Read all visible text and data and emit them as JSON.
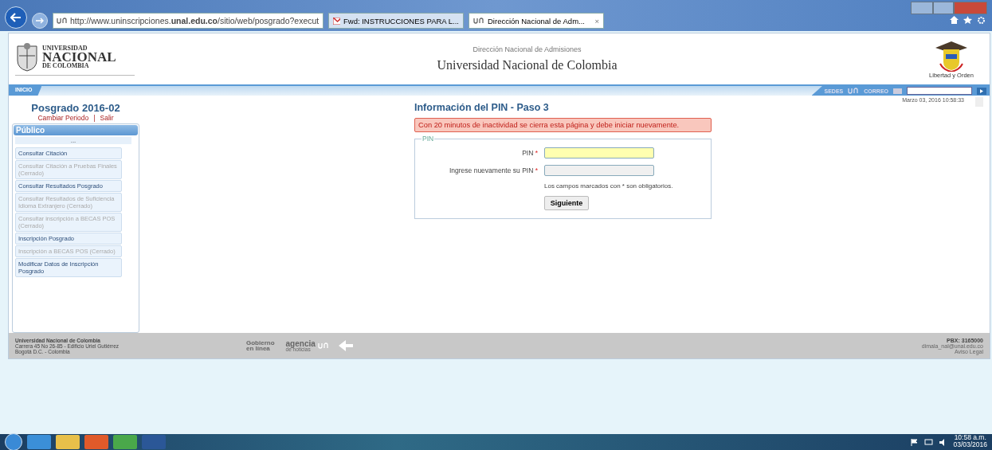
{
  "browser": {
    "address": "http://www.uninscripciones.**unal.edu.co**/sitio/web/posgrado?execut",
    "tabs": [
      {
        "label": "Fwd: INSTRUCCIONES PARA L...",
        "selected": false,
        "kind": "mail"
      },
      {
        "label": "Dirección Nacional de Adm...",
        "selected": true,
        "kind": "site",
        "close": "×"
      }
    ]
  },
  "header": {
    "logo_lines": [
      "UNIVERSIDAD",
      "NACIONAL",
      "DE COLOMBIA"
    ],
    "subtitle": "Dirección Nacional de Admisiones",
    "title": "Universidad Nacional de Colombia",
    "crest_motto": "Libertad y Orden"
  },
  "navbar": {
    "home": "INICIO",
    "links": [
      "SEDES",
      "CORREO"
    ]
  },
  "sidebar": {
    "title": "Posgrado 2016-02",
    "links": [
      "Cambiar Periodo",
      "Salir"
    ],
    "separator": "|",
    "section": "Público",
    "ellipsis": "...",
    "items": [
      {
        "label": "Consultar Citación",
        "disabled": false
      },
      {
        "label": "Consultar Citación a Pruebas Finales (Cerrado)",
        "disabled": true
      },
      {
        "label": "Consultar Resultados Posgrado",
        "disabled": false
      },
      {
        "label": "Consultar Resultados de Suficiencia Idioma Extranjero (Cerrado)",
        "disabled": true
      },
      {
        "label": "Consultar inscripción a BECAS POS (Cerrado)",
        "disabled": true
      },
      {
        "label": "Inscripción Posgrado",
        "disabled": false
      },
      {
        "label": "Inscripción a BECAS POS (Cerrado)",
        "disabled": true
      },
      {
        "label": "Modificar Datos de Inscripción Posgrado",
        "disabled": false
      }
    ]
  },
  "datetime": "Marzo 03, 2016 10:58:33",
  "main": {
    "title": "Información del PIN - Paso 3",
    "alert": "Con 20 minutos de inactividad se cierra esta página y debe iniciar nuevamente.",
    "fieldset": "PIN",
    "fields": [
      {
        "label": "PIN",
        "required": "*",
        "focused": true
      },
      {
        "label": "Ingrese nuevamente su PIN",
        "required": "*",
        "focused": false
      }
    ],
    "note": "Los campos marcados con * son obligatorios.",
    "button": "Siguiente"
  },
  "footer": {
    "left": [
      "Universidad Nacional de Colombia",
      "Carrera 45 No 26-85 - Edificio Uriel Gutiérrez",
      "Bogotá D.C. - Colombia"
    ],
    "gobierno": [
      "Gobierno",
      "en línea"
    ],
    "agencia": "agencia",
    "agencia_sub": "de noticias",
    "right": [
      "PBX: 3165000",
      "dimala_nal@unal.edu.co",
      "Aviso Legal"
    ]
  },
  "taskbar": {
    "time": "10:58 a.m.",
    "date": "03/03/2016"
  }
}
